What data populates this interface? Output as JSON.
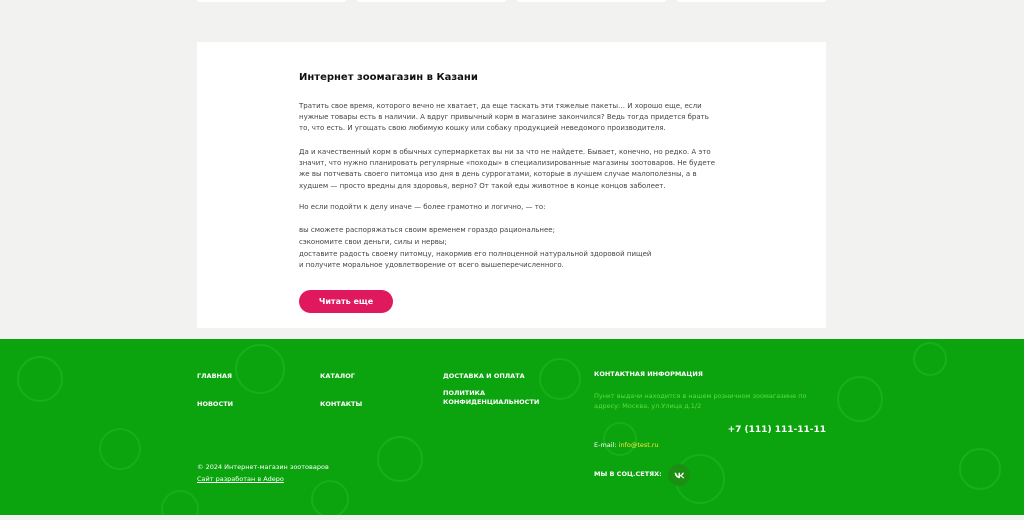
{
  "about": {
    "title": "Интернет зоомагазин в Казани",
    "p1": "Тратить свое время, которого вечно не хватает, да еще таскать эти тяжелые пакеты… И хорошо еще, если нужные товары есть в наличии. А вдруг привычный корм в магазине закончился? Ведь тогда придется брать то, что есть. И угощать свою любимую кошку или собаку продукцией неведомого производителя.",
    "p2": "Да и качественный корм в обычных супермаркетах вы ни за что не найдете. Бывает, конечно, но редко. А это значит, что нужно планировать регулярные «походы» в специализированные магазины зоотоваров. Не будете же вы потчевать своего питомца изо дня в день суррогатами, которые в лучшем случае малополезны, а в худшем — просто вредны для здоровья, верно? От такой еды животное в конце концов заболеет.",
    "p3": "Но если подойти к делу иначе — более грамотно и логично, — то:",
    "list": [
      "вы сможете распоряжаться своим временем гораздо рациональнее;",
      "сэкономите свои деньги, силы и нервы;",
      "доставите радость своему питомцу, накормив его полноценной натуральной здоровой пищей",
      "и получите моральное удовлетворение от всего вышеперечисленного."
    ],
    "read_more": "Читать еще",
    "accent_color": "#e0195f"
  },
  "footer": {
    "bg_color": "#0ca40e",
    "nav": {
      "home": "ГЛАВНАЯ",
      "catalog": "КАТАЛОГ",
      "delivery": "ДОСТАВКА И ОПЛАТА",
      "news": "НОВОСТИ",
      "contacts": "КОНТАКТЫ",
      "privacy_line1": "ПОЛИТИКА",
      "privacy_line2": "КОНФИДЕНЦИАЛЬНОСТИ"
    },
    "contacts_title": "КОНТАКТНАЯ ИНФОРМАЦИЯ",
    "address": "Пункт выдачи находится в нашем розничном зоомагазине по адресу: Москва, ул.Улица д.1/2",
    "phone": "+7 (111) 111-11-11",
    "email_label": "E-mail: ",
    "email": "info@test.ru",
    "social_label": "МЫ В СОЦ.СЕТЯХ:",
    "social_icon": "vk-icon",
    "copyright": "© 2024 Интернет-магазин зоотоваров",
    "developer": "Сайт разработан в Adepo"
  }
}
